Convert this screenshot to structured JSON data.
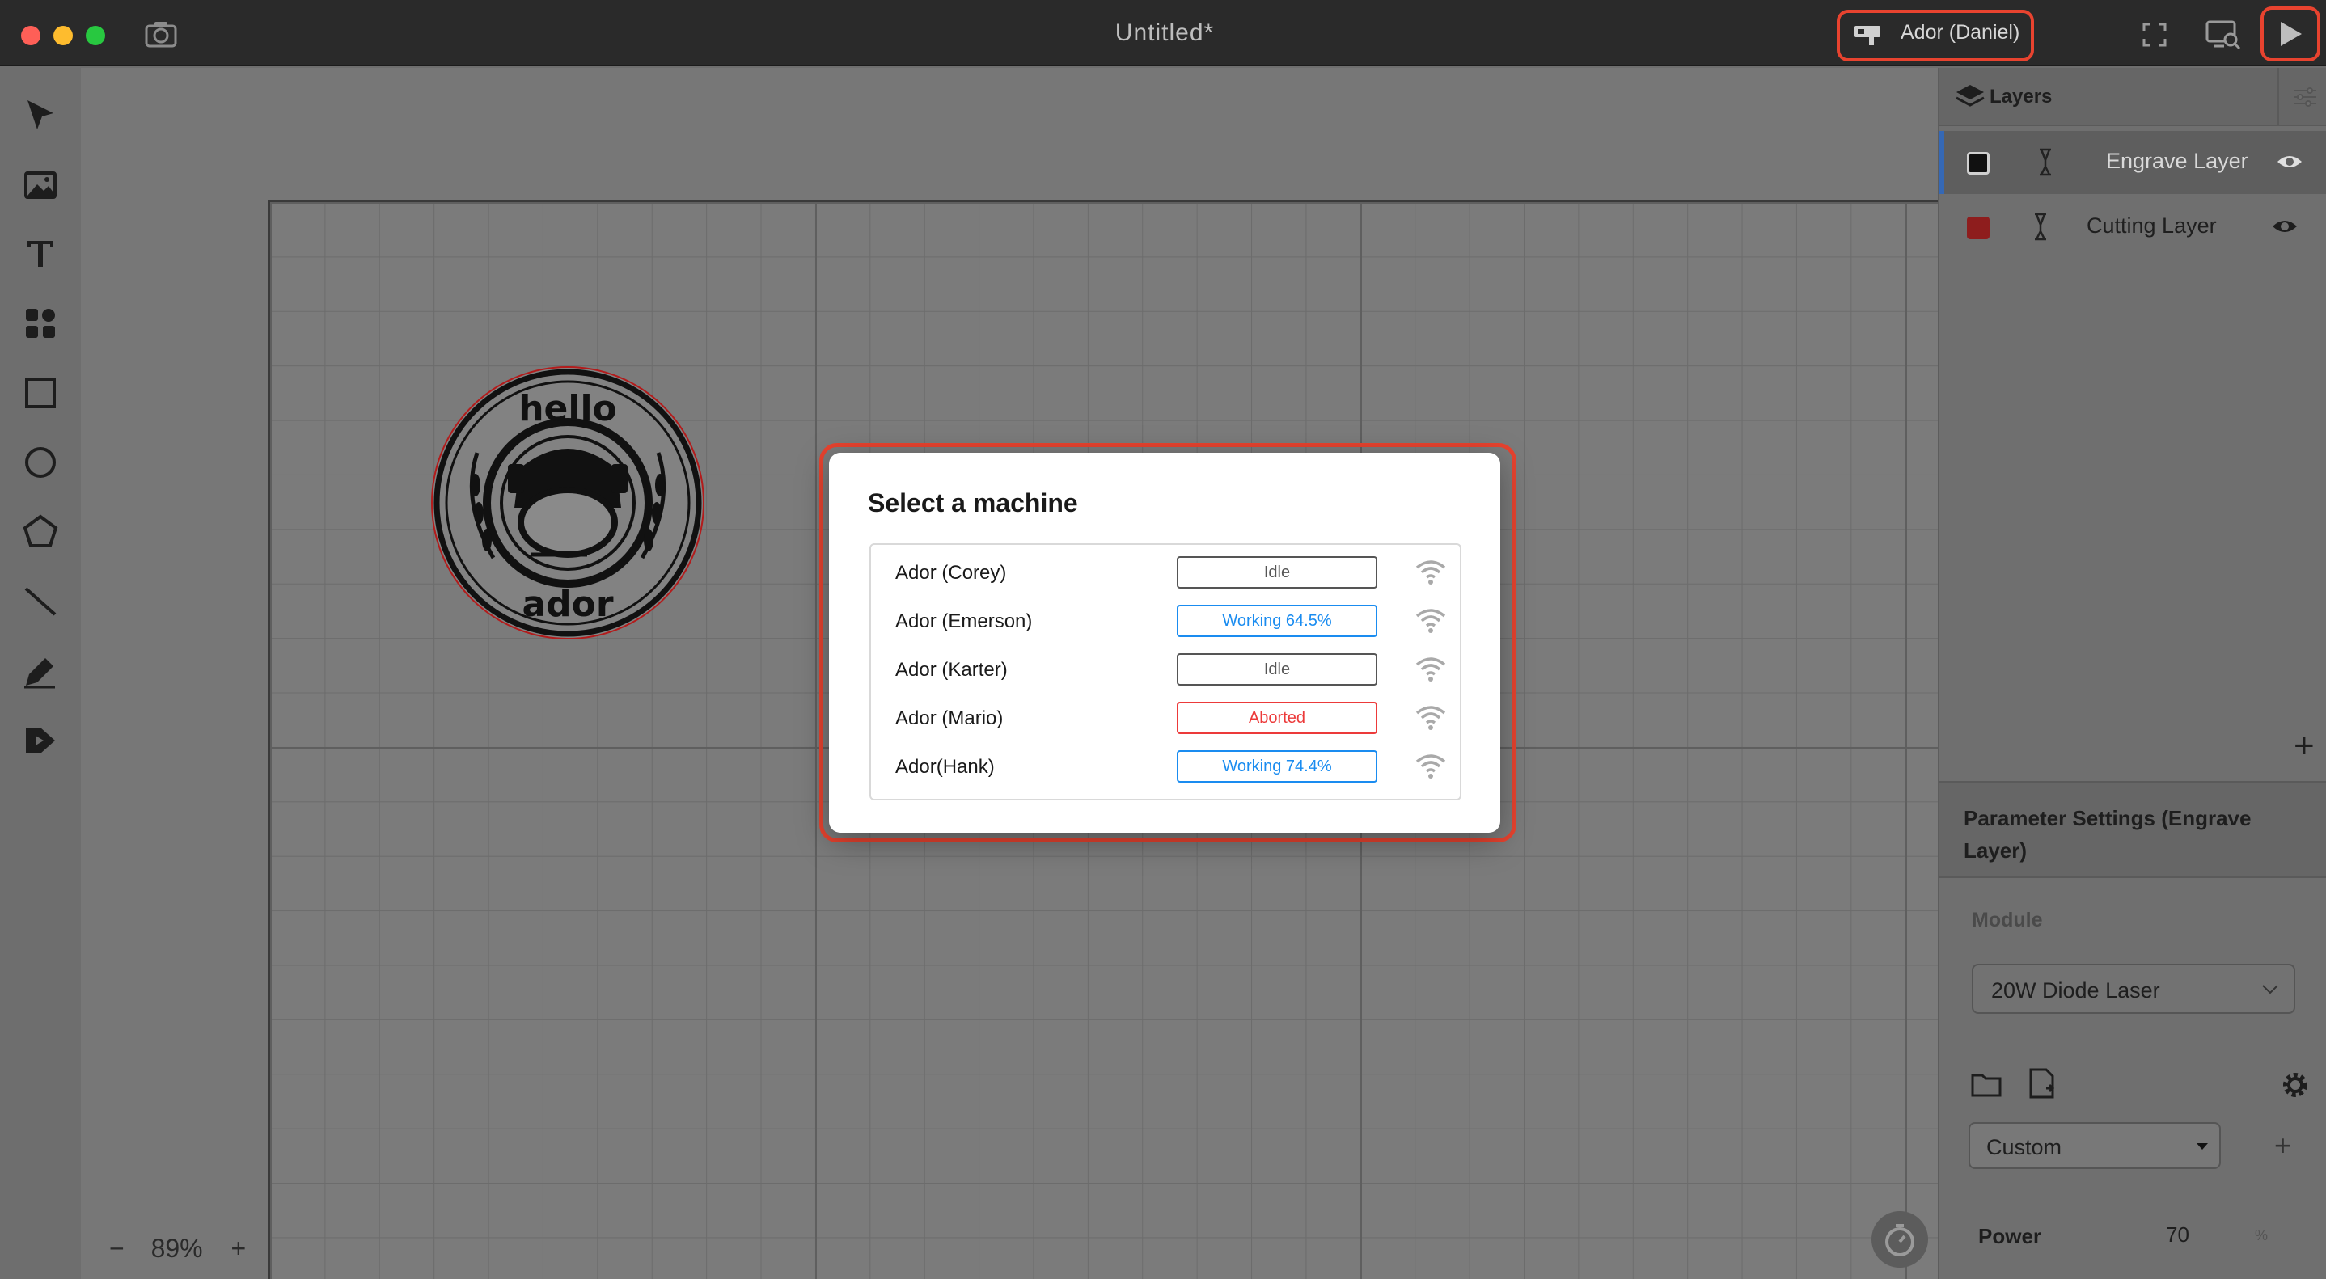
{
  "window": {
    "title": "Untitled*",
    "machine_button_label": "Ador (Daniel)",
    "highlight_color": "#e8432f"
  },
  "toolbar": {
    "tools": [
      "pointer-icon",
      "image-icon",
      "text-icon",
      "elements-icon",
      "rectangle-icon",
      "ellipse-icon",
      "polygon-icon",
      "line-icon",
      "pen-icon",
      "dmkt-icon"
    ]
  },
  "canvas": {
    "zoom": {
      "minus": "−",
      "value": "89%",
      "plus": "+"
    },
    "logo_text": {
      "top": "hello",
      "bottom": "ador"
    }
  },
  "layers": {
    "header": "Layers",
    "add": "+",
    "items": [
      {
        "name": "Engrave Layer",
        "color": "#111111",
        "selected": true
      },
      {
        "name": "Cutting Layer",
        "color": "#8e1d1d",
        "selected": false
      }
    ]
  },
  "params": {
    "header": "Parameter Settings (Engrave Layer)",
    "module_label": "Module",
    "module_value": "20W Diode Laser",
    "preset_value": "Custom",
    "preset_add": "+",
    "power_label": "Power",
    "power_value": "70",
    "power_unit": "%"
  },
  "modal": {
    "title": "Select a machine",
    "machines": [
      {
        "name": "Ador (Corey)",
        "status": "Idle",
        "state": "idle"
      },
      {
        "name": "Ador (Emerson)",
        "status": "Working 64.5%",
        "state": "working"
      },
      {
        "name": "Ador (Karter)",
        "status": "Idle",
        "state": "idle"
      },
      {
        "name": "Ador (Mario)",
        "status": "Aborted",
        "state": "aborted"
      },
      {
        "name": "Ador(Hank)",
        "status": "Working 74.4%",
        "state": "working"
      }
    ]
  }
}
